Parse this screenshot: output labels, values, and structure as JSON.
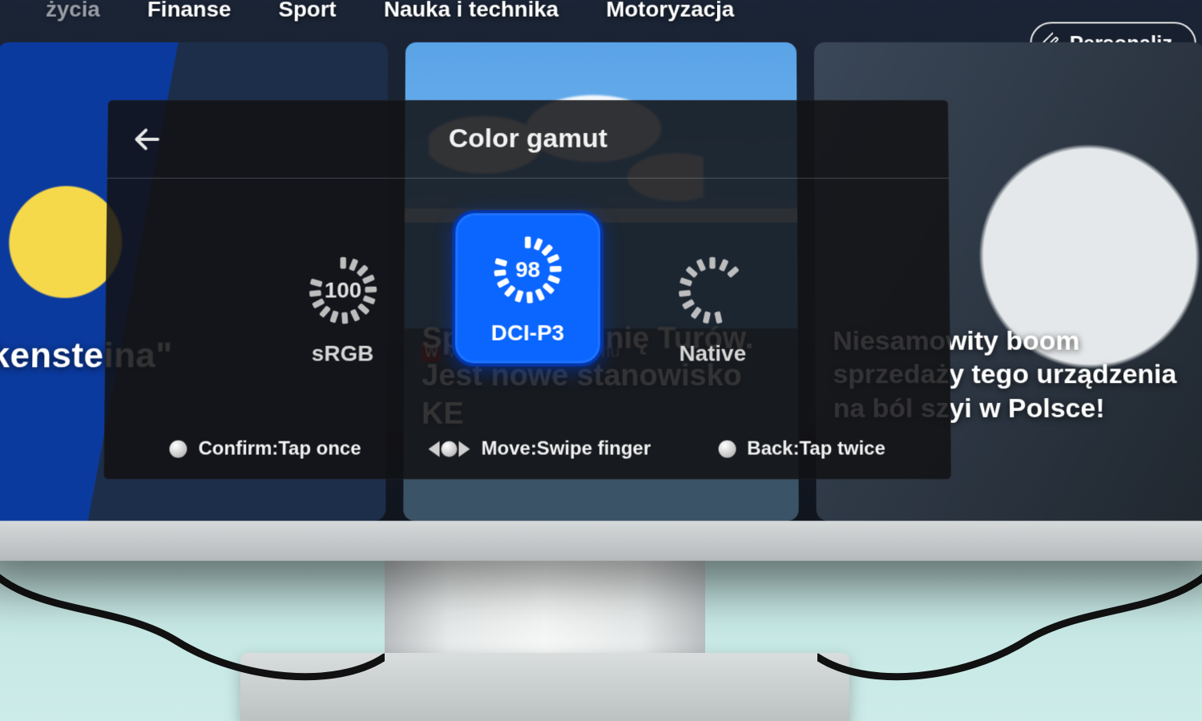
{
  "background_page": {
    "nav_items": [
      "Finanse",
      "Sport",
      "Nauka i technika",
      "Motoryzacja"
    ],
    "nav_item_partial_left": "życia",
    "personalize_label": "Personaliz",
    "cards": [
      {
        "headline_fragment": "kensteina\""
      },
      {
        "source_badge": "W",
        "source_text": "Wprost · 2 godz. temu",
        "headline": "Spór o kopalnię Turów. Jest nowe stanowisko KE"
      },
      {
        "headline": "Niesamowity boom sprzedaży tego urządzenia na ból szyi w Polsce!"
      }
    ]
  },
  "osd": {
    "title": "Color gamut",
    "options": [
      {
        "id": "srgb",
        "label": "sRGB",
        "value": "100",
        "selected": false
      },
      {
        "id": "dcip3",
        "label": "DCI-P3",
        "value": "98",
        "selected": true
      },
      {
        "id": "native",
        "label": "Native",
        "value": "",
        "selected": false
      }
    ],
    "hints": {
      "confirm": "Confirm:Tap once",
      "move": "Move:Swipe finger",
      "back": "Back:Tap twice"
    }
  }
}
